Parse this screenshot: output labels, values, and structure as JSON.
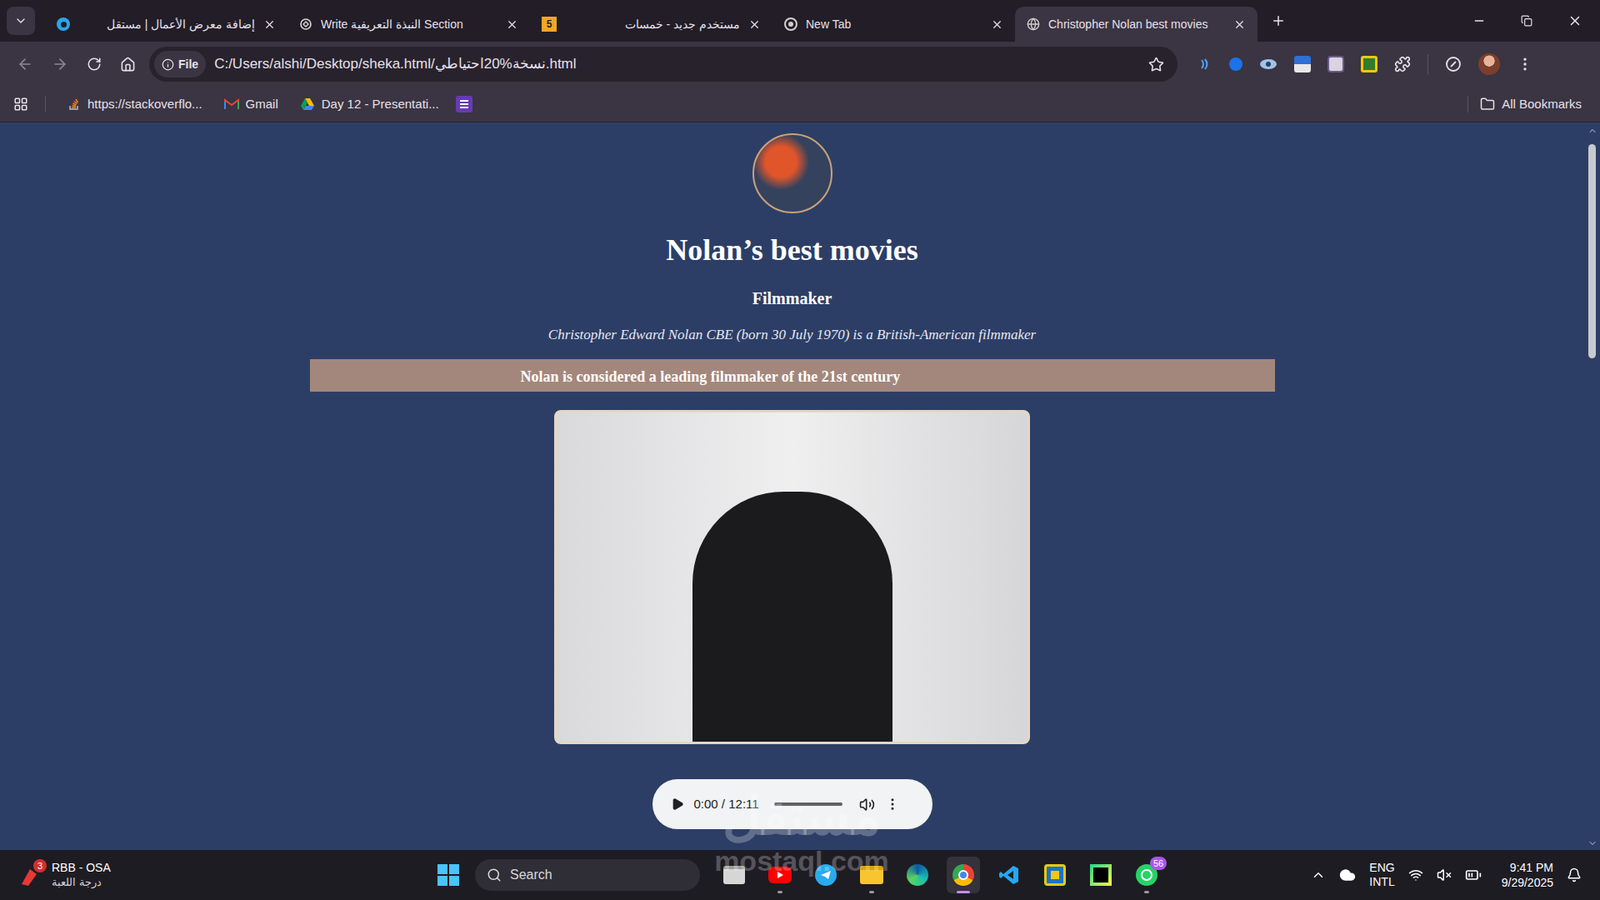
{
  "browser": {
    "tabs": [
      {
        "title": "إضافة معرض الأعمال | مستقل",
        "kind": "mostaql",
        "favicon_text": "",
        "selected": false
      },
      {
        "title": "Write النبذة التعريفية Section",
        "kind": "chatgpt",
        "favicon_text": "",
        "selected": false
      },
      {
        "title": "مستخدم جديد - خمسات",
        "kind": "khamsat",
        "favicon_text": "5",
        "selected": false
      },
      {
        "title": "New Tab",
        "kind": "chrome",
        "favicon_text": "",
        "selected": false
      },
      {
        "title": "Christopher Nolan best movies",
        "kind": "globe",
        "favicon_text": "",
        "selected": true
      }
    ],
    "address": {
      "chip": "File",
      "url": "C:/Users/alshi/Desktop/sheka.html/نسخة%20احتياطي.html"
    },
    "bookmarks": [
      {
        "label": "https://stackoverflo...",
        "kind": "stackoverflow"
      },
      {
        "label": "Gmail",
        "kind": "gmail"
      },
      {
        "label": "Day 12 - Presentati...",
        "kind": "drive"
      }
    ],
    "all_bookmarks": "All Bookmarks"
  },
  "page": {
    "heading": "Nolan’s best movies",
    "subtitle": "Filmmaker",
    "intro": "Christopher Edward Nolan CBE (born 30 July 1970) is a British-American filmmaker",
    "banner": "Nolan is considered a leading filmmaker of the 21st century",
    "audio": {
      "time": "0:00 / 12:11",
      "level": 0,
      "playing": false
    }
  },
  "watermark": {
    "arabic": "مستقل",
    "latin": "mostaql.com"
  },
  "taskbar": {
    "widget": {
      "title": "RBB - OSA",
      "subtitle": "درجة اللعبة",
      "badge": "3"
    },
    "search": "Search",
    "apps": [
      {
        "kind": "files",
        "badge": "",
        "running": false,
        "selected": false
      },
      {
        "kind": "youtube",
        "badge": "",
        "running": true,
        "selected": false
      },
      {
        "kind": "telegram",
        "badge": "",
        "running": false,
        "selected": false
      },
      {
        "kind": "explorer",
        "badge": "",
        "running": true,
        "selected": false
      },
      {
        "kind": "edge",
        "badge": "",
        "running": false,
        "selected": false
      },
      {
        "kind": "chrome",
        "badge": "",
        "running": true,
        "selected": true
      },
      {
        "kind": "vscode",
        "badge": "",
        "running": false,
        "selected": false
      },
      {
        "kind": "pbi",
        "badge": "",
        "running": false,
        "selected": false
      },
      {
        "kind": "pycharm",
        "badge": "",
        "running": false,
        "selected": false
      },
      {
        "kind": "whatsapp",
        "badge": "56",
        "running": true,
        "selected": false
      }
    ],
    "language": [
      "ENG",
      "INTL"
    ],
    "time": "9:41 PM",
    "date": "9/29/2025"
  }
}
